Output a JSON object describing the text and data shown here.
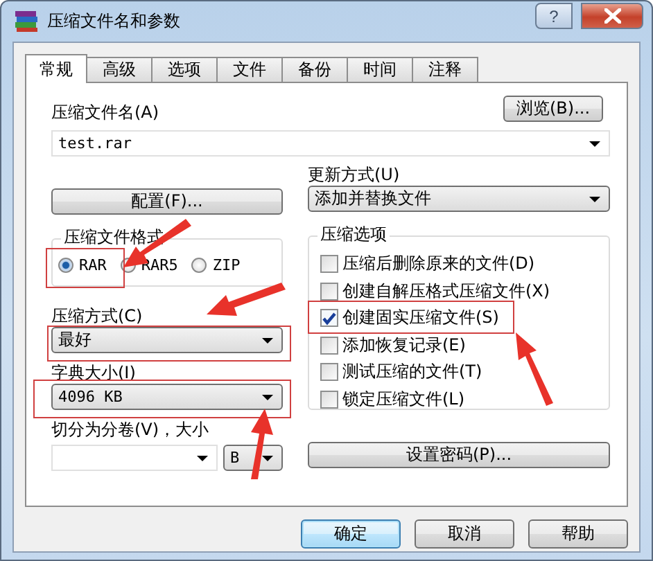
{
  "window": {
    "title": "压缩文件名和参数",
    "help_button": "?"
  },
  "tabs": [
    {
      "label": "常规",
      "selected": true
    },
    {
      "label": "高级",
      "selected": false
    },
    {
      "label": "选项",
      "selected": false
    },
    {
      "label": "文件",
      "selected": false
    },
    {
      "label": "备份",
      "selected": false
    },
    {
      "label": "时间",
      "selected": false
    },
    {
      "label": "注释",
      "selected": false
    }
  ],
  "archive_name": {
    "label": "压缩文件名(A)",
    "value": "test.rar",
    "browse_button": "浏览(B)..."
  },
  "profiles_button": "配置(F)...",
  "update_mode": {
    "label": "更新方式(U)",
    "value": "添加并替换文件"
  },
  "archive_format": {
    "title": "压缩文件格式",
    "options": [
      {
        "label": "RAR",
        "selected": true
      },
      {
        "label": "RAR5",
        "selected": false
      },
      {
        "label": "ZIP",
        "selected": false
      }
    ]
  },
  "compression_method": {
    "label": "压缩方式(C)",
    "value": "最好"
  },
  "dictionary_size": {
    "label": "字典大小(I)",
    "value": "4096 KB"
  },
  "split_volumes": {
    "label": "切分为分卷(V)，大小",
    "unit": "B"
  },
  "archive_options": {
    "title": "压缩选项",
    "options": [
      {
        "label": "压缩后删除原来的文件(D)",
        "checked": false
      },
      {
        "label": "创建自解压格式压缩文件(X)",
        "checked": false
      },
      {
        "label": "创建固实压缩文件(S)",
        "checked": true
      },
      {
        "label": "添加恢复记录(E)",
        "checked": false
      },
      {
        "label": "测试压缩的文件(T)",
        "checked": false
      },
      {
        "label": "锁定压缩文件(L)",
        "checked": false
      }
    ]
  },
  "password_button": "设置密码(P)...",
  "buttons": [
    {
      "label": "确定",
      "default": true
    },
    {
      "label": "取消",
      "default": false
    },
    {
      "label": "帮助",
      "default": false
    }
  ]
}
